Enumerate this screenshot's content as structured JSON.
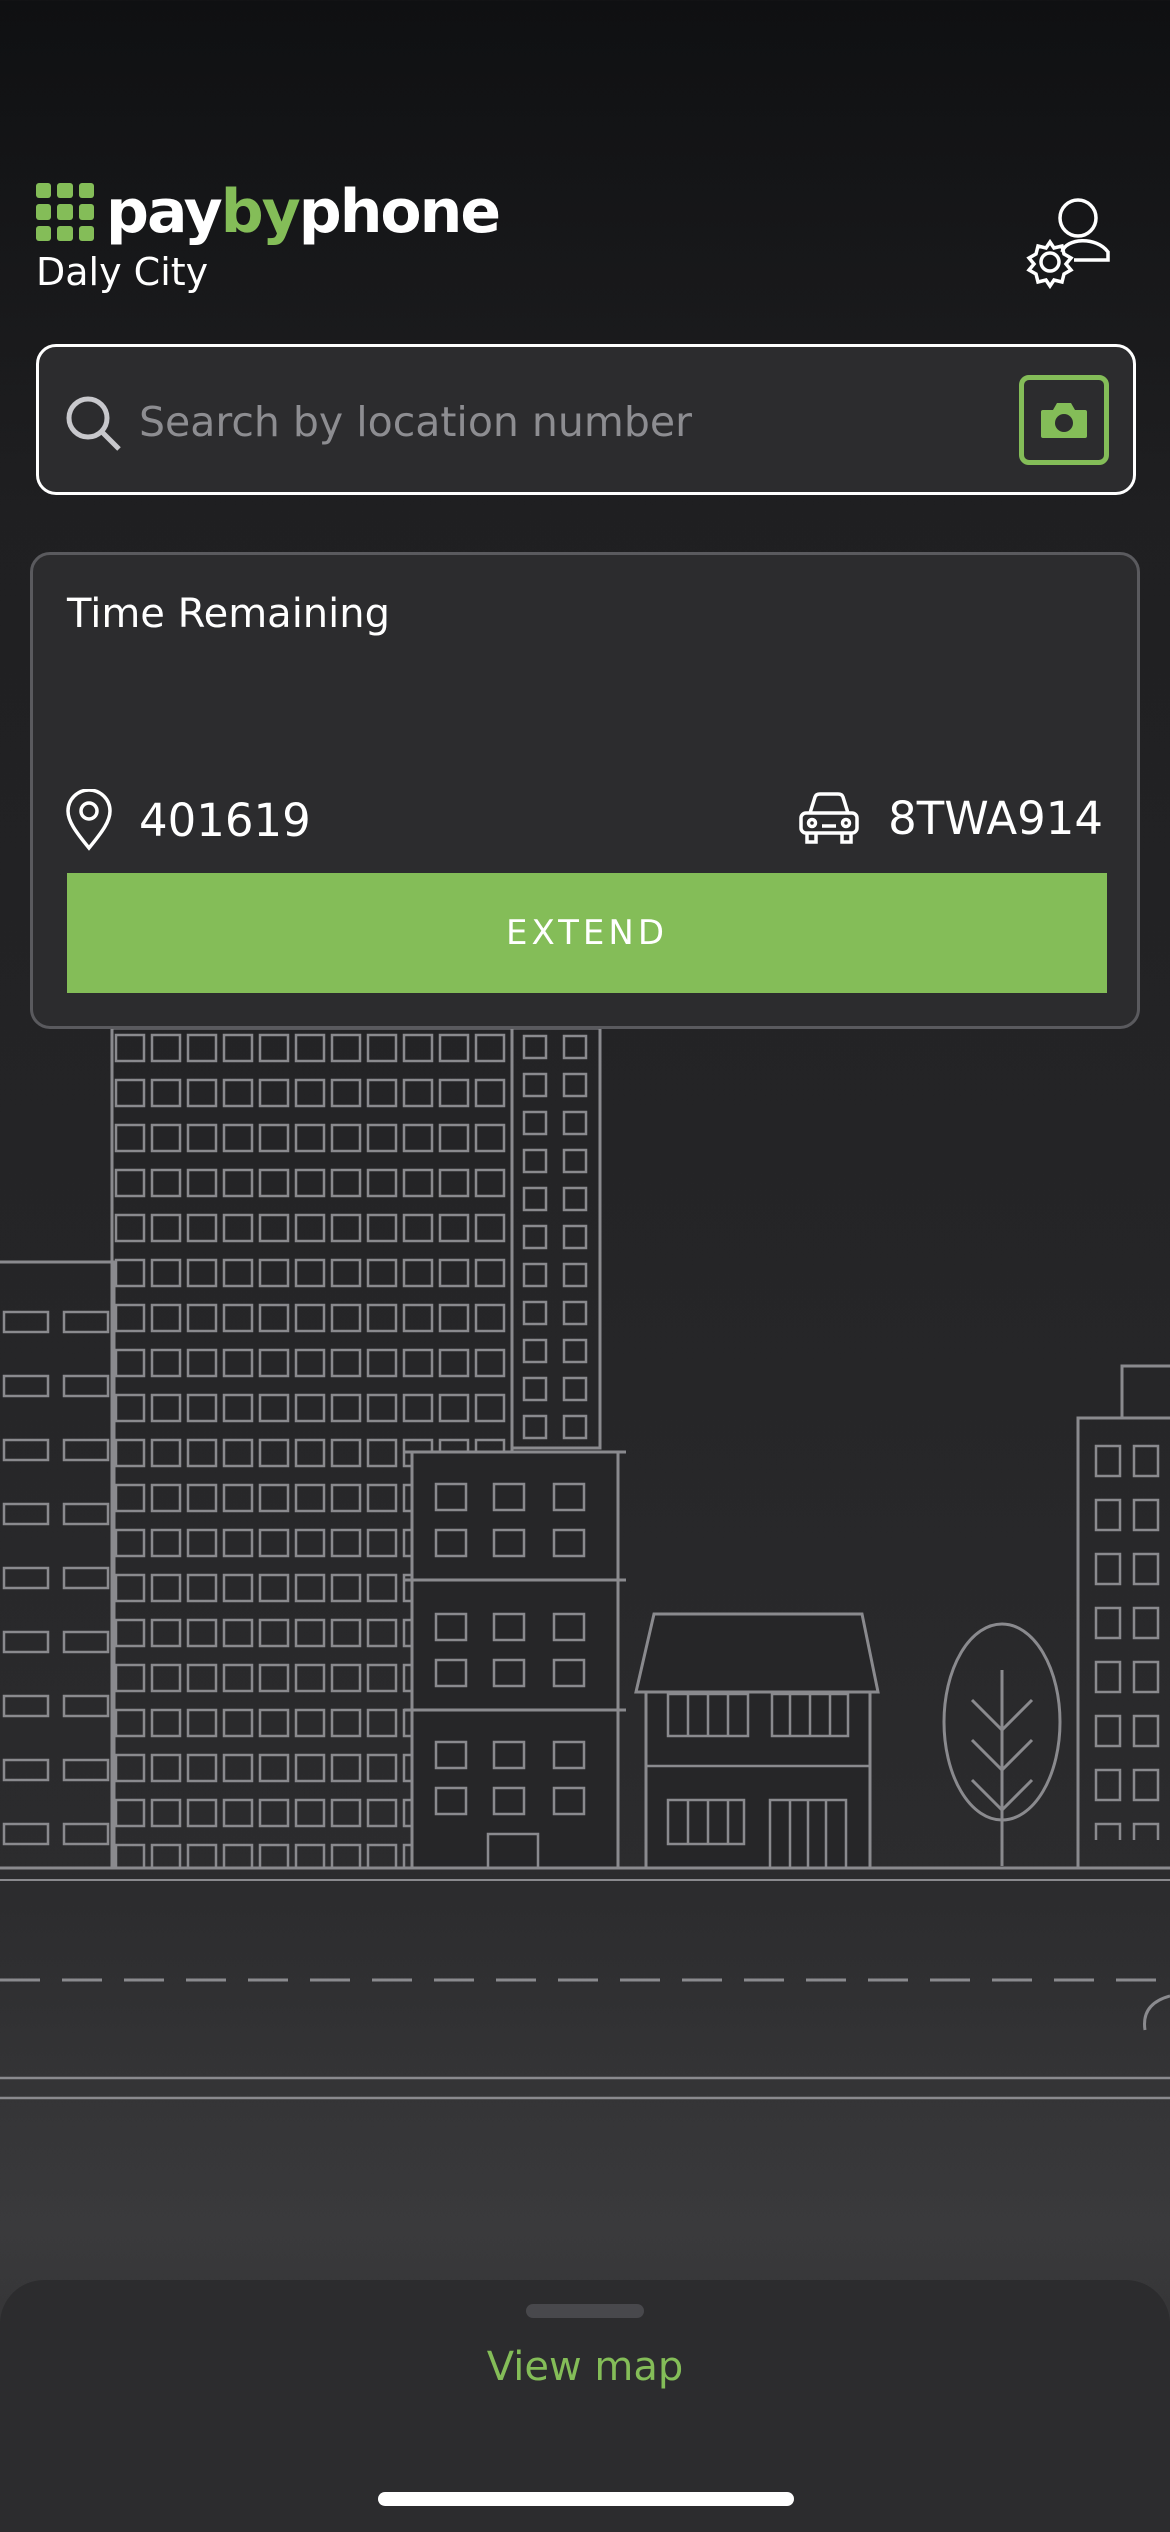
{
  "header": {
    "brand_parts": [
      "pay",
      "by",
      "phone"
    ],
    "city": "Daly City",
    "account_icon": "account-settings-icon"
  },
  "search": {
    "placeholder": "Search by location number",
    "search_icon": "search-icon",
    "camera_icon": "camera-icon"
  },
  "session": {
    "title": "Time Remaining",
    "location_number": "401619",
    "plate": "8TWA914",
    "extend_label": "EXTEND"
  },
  "sheet": {
    "view_map_label": "View map"
  },
  "colors": {
    "accent": "#84bd58",
    "background": "#262628",
    "card": "#2c2c2e"
  }
}
